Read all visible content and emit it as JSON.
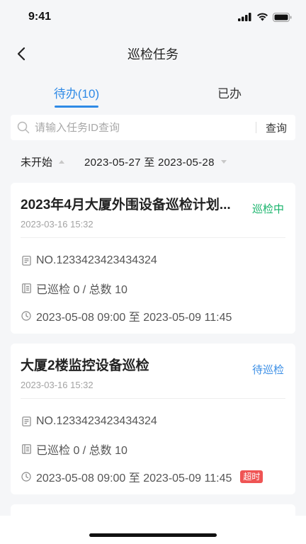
{
  "status_bar": {
    "time": "9:41"
  },
  "nav": {
    "title": "巡检任务"
  },
  "tabs": [
    {
      "label": "待办(10)",
      "active": true
    },
    {
      "label": "已办",
      "active": false
    }
  ],
  "search": {
    "placeholder": "请输入任务ID查询",
    "value": "",
    "button_label": "查询"
  },
  "filter": {
    "status_label": "未开始",
    "date_range": "2023-05-27 至 2023-05-28"
  },
  "colors": {
    "accent": "#2f8ae6",
    "status_in_progress": "#16b36a",
    "status_pending": "#3a8ee6",
    "overtime_badge": "#ef5454"
  },
  "tasks": [
    {
      "title": "2023年4月大厦外围设备巡检计划...",
      "created": "2023-03-16 15:32",
      "status": "巡检中",
      "number": "NO.1233423423434324",
      "progress": "已巡检 0 / 总数 10",
      "period": "2023-05-08 09:00 至 2023-05-09 11:45",
      "badge": ""
    },
    {
      "title": "大厦2楼监控设备巡检",
      "created": "2023-03-16 15:32",
      "status": "待巡检",
      "number": "NO.1233423423434324",
      "progress": "已巡检 0 / 总数 10",
      "period": "2023-05-08 09:00 至 2023-05-09 11:45",
      "badge": "超时"
    }
  ]
}
